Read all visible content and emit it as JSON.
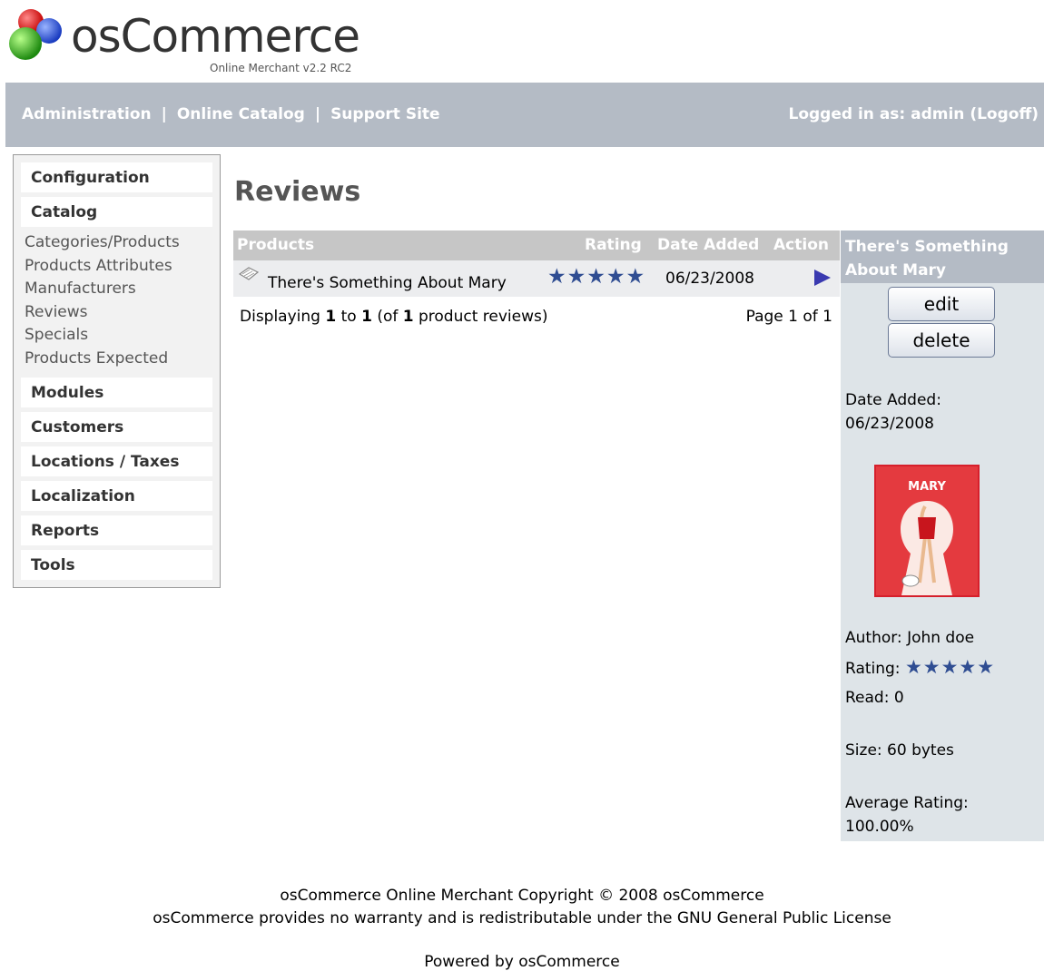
{
  "header": {
    "logo_word": "osCommerce",
    "logo_sub": "Online Merchant v2.2 RC2",
    "nav": [
      "Administration",
      "Online Catalog",
      "Support Site"
    ],
    "nav_separator": "|",
    "logged_in": "Logged in as: admin (Logoff)"
  },
  "sidebar": {
    "boxes": [
      "Configuration",
      "Catalog",
      "Modules",
      "Customers",
      "Locations / Taxes",
      "Localization",
      "Reports",
      "Tools"
    ],
    "catalog_items": [
      "Categories/Products",
      "Products Attributes",
      "Manufacturers",
      "Reviews",
      "Specials",
      "Products Expected"
    ]
  },
  "main": {
    "title": "Reviews",
    "columns": [
      "Products",
      "Rating",
      "Date Added",
      "Action"
    ],
    "row": {
      "product": "There's Something About Mary",
      "rating_stars": "★★★★★",
      "date_added": "06/23/2008"
    },
    "display_prefix": "Displaying ",
    "display_from": "1",
    "display_to_word": " to ",
    "display_to": "1",
    "display_of_prefix": " (of ",
    "display_total": "1",
    "display_suffix": " product reviews)",
    "page_info": "Page 1 of 1"
  },
  "info_panel": {
    "heading": "There's Something About Mary",
    "edit_label": "edit",
    "delete_label": "delete",
    "date_added_label": "Date Added:",
    "date_added_value": "06/23/2008",
    "poster_title": "MARY",
    "author": "Author: John doe",
    "rating_label": "Rating: ",
    "rating_stars": "★★★★★",
    "read": "Read: 0",
    "size": "Size: 60 bytes",
    "average_label": "Average Rating:",
    "average_value": "100.00%"
  },
  "footer": {
    "copyright": "osCommerce Online Merchant Copyright © 2008 osCommerce",
    "warranty": "osCommerce provides no warranty and is redistributable under the GNU General Public License",
    "powered": "Powered by osCommerce"
  },
  "colors": {
    "topbar": "#b4bbc5",
    "table_header": "#c6c6c6",
    "info_panel": "#dee4e8",
    "stars": "#2f4d92",
    "action_arrow": "#3a3ab0"
  }
}
